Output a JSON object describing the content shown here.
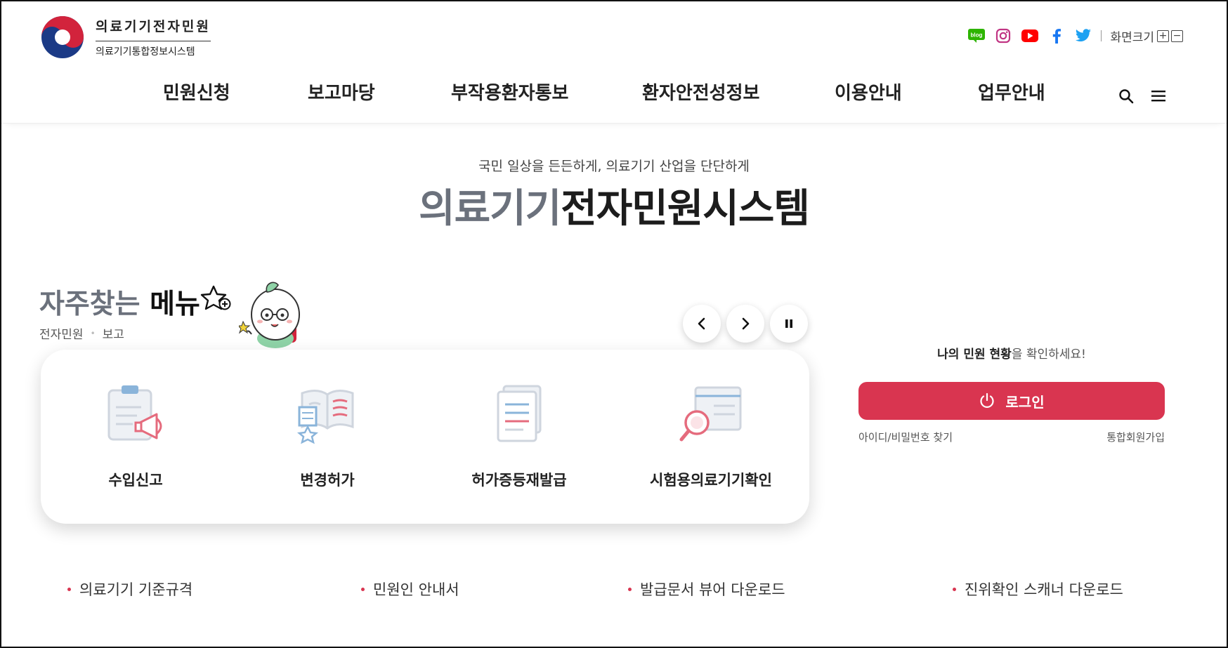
{
  "header": {
    "logo_title": "의료기기전자민원",
    "logo_subtitle": "의료기기통합정보시스템",
    "zoom_label": "화면크기",
    "zoom_in": "+",
    "zoom_out": "−",
    "sns_icons": [
      "blog-icon",
      "instagram-icon",
      "youtube-icon",
      "facebook-icon",
      "twitter-icon"
    ]
  },
  "nav": {
    "items": [
      "민원신청",
      "보고마당",
      "부작용환자통보",
      "환자안전성정보",
      "이용안내",
      "업무안내"
    ]
  },
  "hero": {
    "subtitle": "국민 일상을 든든하게, 의료기기 산업을 단단하게",
    "title_part1": "의료기기",
    "title_part2": "전자민원시스템"
  },
  "favorites": {
    "title_part1": "자주찾는 ",
    "title_part2": "메뉴",
    "tabs": [
      "전자민원",
      "보고"
    ],
    "items": [
      "수입신고",
      "변경허가",
      "허가증등재발급",
      "시험용의료기기확인"
    ]
  },
  "login": {
    "message_bold": "나의 민원 현황",
    "message_rest": "을 확인하세요!",
    "button_label": "로그인",
    "find_account": "아이디/비밀번호 찾기",
    "signup": "통합회원가입"
  },
  "downloads": [
    "의료기기 기준규격",
    "민원인 안내서",
    "발급문서 뷰어 다운로드",
    "진위확인 스캐너 다운로드"
  ],
  "colors": {
    "accent": "#d93550",
    "title_gray": "#6b717c",
    "text_dark": "#222222"
  }
}
